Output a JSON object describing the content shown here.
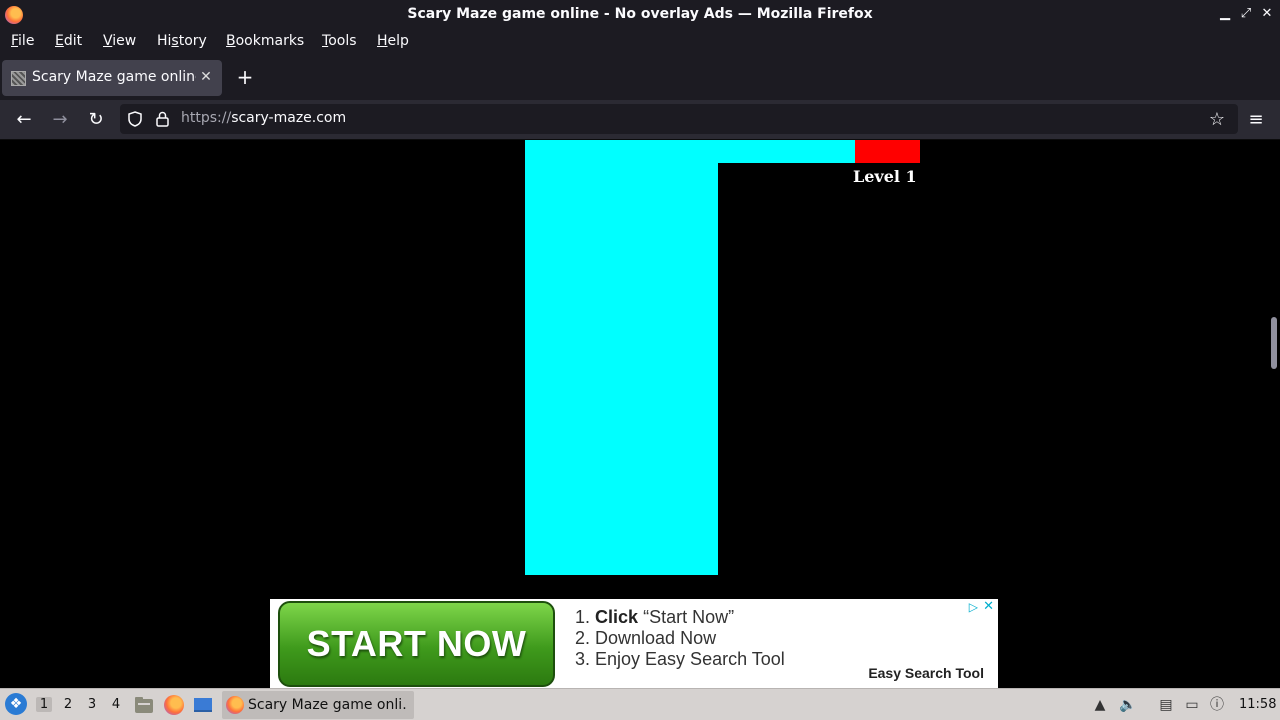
{
  "window": {
    "title": "Scary Maze game online - No overlay Ads — Mozilla Firefox",
    "minimize_glyph": "▁",
    "maximize_glyph": "⤢",
    "close_glyph": "✕"
  },
  "menubar": {
    "items": [
      {
        "pre": "",
        "u": "F",
        "post": "ile"
      },
      {
        "pre": "",
        "u": "E",
        "post": "dit"
      },
      {
        "pre": "",
        "u": "V",
        "post": "iew"
      },
      {
        "pre": "Hi",
        "u": "s",
        "post": "tory"
      },
      {
        "pre": "",
        "u": "B",
        "post": "ookmarks"
      },
      {
        "pre": "",
        "u": "T",
        "post": "ools"
      },
      {
        "pre": "",
        "u": "H",
        "post": "elp"
      }
    ]
  },
  "tabs": [
    {
      "title": "Scary Maze game online - No overlay Ads",
      "close": "✕",
      "active": true
    }
  ],
  "newtab": "+",
  "nav": {
    "back": "←",
    "forward": "→",
    "reload": "↻",
    "url_scheme": "https://",
    "url_host": "scary-maze.com",
    "bookmark_star": "☆",
    "menu": "≡"
  },
  "game": {
    "level_label": "Level 1",
    "colors": {
      "path": "#00ffff",
      "goal": "#ff0000",
      "background": "#000000"
    }
  },
  "ad": {
    "button": "START NOW",
    "step1_num": "1.",
    "step1_bold": "Click",
    "step1_rest": "“Start Now”",
    "step2": "2. Download Now",
    "step3": "3. Enjoy Easy Search Tool",
    "brand": "Easy Search Tool",
    "adchoices": "▷",
    "close": "✕"
  },
  "taskbar": {
    "workspaces": [
      "1",
      "2",
      "3",
      "4"
    ],
    "active_workspace": "1",
    "task_label": "Scary Maze game onli…",
    "clock": "11:58"
  }
}
